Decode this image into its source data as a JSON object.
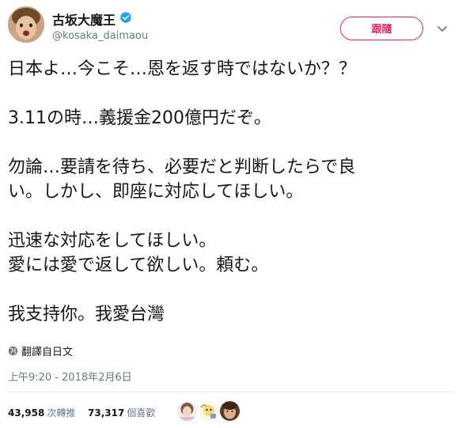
{
  "user": {
    "display_name": "古坂大魔王",
    "handle": "@kosaka_daimaou",
    "verified": true,
    "avatar_icon": "profile-photo"
  },
  "actions": {
    "follow_label": "跟隨",
    "menu_icon": "chevron-down-icon"
  },
  "tweet": {
    "lines": [
      "日本よ…今こそ…恩を返す時ではないか？？",
      "",
      "3.11の時…義援金200億円だぞ。",
      "",
      "勿論…要請を待ち、必要だと判断したらで良",
      "い。しかし、即座に対応してほしい。",
      "",
      "迅速な対応をしてほしい。",
      "愛には愛で返して欲しい。頼む。",
      "",
      "我支持你。我愛台灣"
    ]
  },
  "translate": {
    "label": "翻譯自日文",
    "icon": "globe-icon"
  },
  "timestamp": "上午9:20 - 2018年2月6日",
  "stats": {
    "retweets_count": "43,958",
    "retweets_label": "次轉推",
    "likes_count": "73,317",
    "likes_label": "個喜歡"
  },
  "colors": {
    "text": "#14171a",
    "muted": "#657786",
    "follow_accent": "#e0245e",
    "verified": "#1da1f2",
    "divider": "#e6ecf0"
  }
}
